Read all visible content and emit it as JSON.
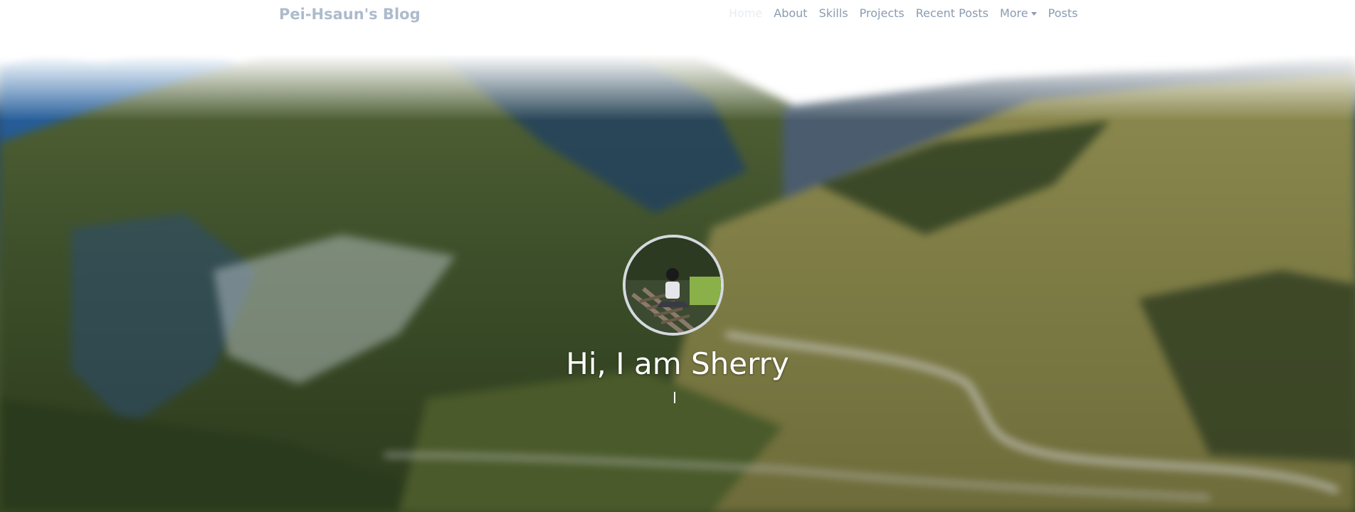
{
  "navbar": {
    "brand": "Pei-Hsaun's Blog",
    "links": [
      {
        "label": "Home",
        "active": true
      },
      {
        "label": "About",
        "active": false
      },
      {
        "label": "Skills",
        "active": false
      },
      {
        "label": "Projects",
        "active": false
      },
      {
        "label": "Recent Posts",
        "active": false
      },
      {
        "label": "More",
        "active": false,
        "dropdown": true
      },
      {
        "label": "Posts",
        "active": false
      }
    ]
  },
  "hero": {
    "greeting": "Hi, I am Sherry",
    "avatar_icon": "profile-photo"
  },
  "colors": {
    "nav_text": "#8a9bb0",
    "nav_active": "#e8edf2",
    "brand": "#9fb0c4",
    "greeting": "#ffffff"
  }
}
